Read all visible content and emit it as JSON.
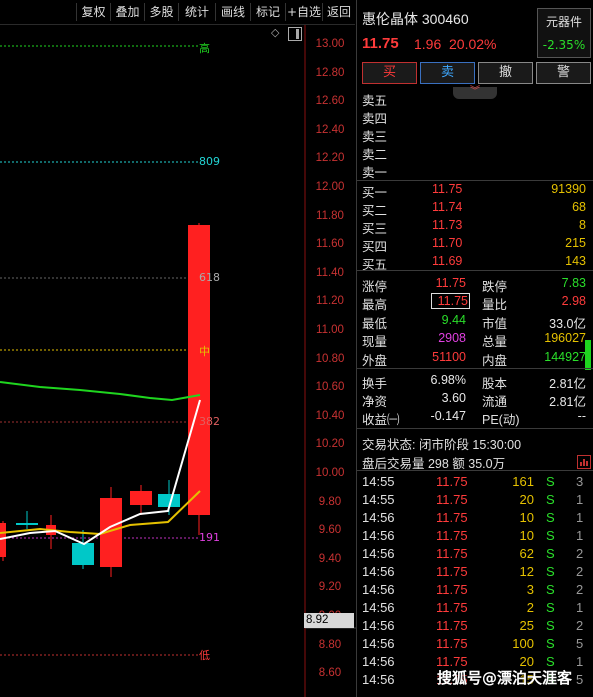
{
  "toolbar": {
    "buttons": [
      "复权",
      "叠加",
      "多股",
      "统计",
      "画线",
      "标记",
      "+自选",
      "返回"
    ]
  },
  "chart": {
    "y_ticks": [
      "13.00",
      "12.80",
      "12.60",
      "12.40",
      "12.20",
      "12.00",
      "11.80",
      "11.60",
      "11.40",
      "11.20",
      "11.00",
      "10.80",
      "10.60",
      "10.40",
      "10.20",
      "10.00",
      "9.80",
      "9.60",
      "9.40",
      "9.20",
      "9.00",
      "8.80",
      "8.60"
    ],
    "hline_labels": {
      "top": "高",
      "fib809": "809",
      "fib618": "618",
      "mid": "中",
      "fib382": "382",
      "fib191": "191",
      "low": "低"
    },
    "cursor_price": "8.92",
    "colors": {
      "up": "#ff2020",
      "down": "#00c8c8",
      "ma_white": "#ffffff",
      "ma_yellow": "#e5c100",
      "ma_green": "#1fd61f"
    }
  },
  "stock": {
    "name_code": "惠伦晶体 300460",
    "price": "11.75",
    "change": "1.96",
    "change_pct": "20.02%",
    "sector_name": "元器件",
    "sector_pct": "-2.35%"
  },
  "trade_buttons": [
    "买",
    "卖",
    "撤",
    "警"
  ],
  "sell_levels": [
    "卖五",
    "卖四",
    "卖三",
    "卖二",
    "卖一"
  ],
  "buy_levels": [
    {
      "label": "买一",
      "price": "11.75",
      "vol": "91390"
    },
    {
      "label": "买二",
      "price": "11.74",
      "vol": "68"
    },
    {
      "label": "买三",
      "price": "11.73",
      "vol": "8"
    },
    {
      "label": "买四",
      "price": "11.70",
      "vol": "215"
    },
    {
      "label": "买五",
      "price": "11.69",
      "vol": "143"
    }
  ],
  "stats": {
    "zhangting_l": "涨停",
    "zhangting": "11.75",
    "dieting_l": "跌停",
    "dieting": "7.83",
    "high_l": "最高",
    "high": "11.75",
    "liangbi_l": "量比",
    "liangbi": "2.98",
    "low_l": "最低",
    "low": "9.44",
    "shizhi_l": "市值",
    "shizhi": "33.0亿",
    "xianliang_l": "现量",
    "xianliang": "2908",
    "zongliang_l": "总量",
    "zongliang": "196027",
    "waipan_l": "外盘",
    "waipan": "51100",
    "neipan_l": "内盘",
    "neipan": "144927",
    "huanshou_l": "换手",
    "huanshou": "6.98%",
    "guben_l": "股本",
    "guben": "2.81亿",
    "jingzi_l": "净资",
    "jingzi": "3.60",
    "liutong_l": "流通",
    "liutong": "2.81亿",
    "shouyi_l": "收益㈠",
    "shouyi": "-0.147",
    "pe_l": "PE(动)",
    "pe": "--"
  },
  "status": {
    "trade_state": "交易状态: 闭市阶段 15:30:00",
    "after_hours": "盘后交易量 298 额 35.0万"
  },
  "ticks": [
    {
      "time": "14:55",
      "price": "11.75",
      "vol": "161",
      "side": "S",
      "n": "3"
    },
    {
      "time": "14:55",
      "price": "11.75",
      "vol": "20",
      "side": "S",
      "n": "1"
    },
    {
      "time": "14:56",
      "price": "11.75",
      "vol": "10",
      "side": "S",
      "n": "1"
    },
    {
      "time": "14:56",
      "price": "11.75",
      "vol": "10",
      "side": "S",
      "n": "1"
    },
    {
      "time": "14:56",
      "price": "11.75",
      "vol": "62",
      "side": "S",
      "n": "2"
    },
    {
      "time": "14:56",
      "price": "11.75",
      "vol": "12",
      "side": "S",
      "n": "2"
    },
    {
      "time": "14:56",
      "price": "11.75",
      "vol": "3",
      "side": "S",
      "n": "2"
    },
    {
      "time": "14:56",
      "price": "11.75",
      "vol": "2",
      "side": "S",
      "n": "1"
    },
    {
      "time": "14:56",
      "price": "11.75",
      "vol": "25",
      "side": "S",
      "n": "2"
    },
    {
      "time": "14:56",
      "price": "11.75",
      "vol": "100",
      "side": "S",
      "n": "5"
    },
    {
      "time": "14:56",
      "price": "11.75",
      "vol": "20",
      "side": "S",
      "n": "1"
    },
    {
      "time": "14:56",
      "price": "11.75",
      "vol": "15",
      "side": "S",
      "n": "5"
    }
  ],
  "watermark": "搜狐号@漂泊天涯客"
}
